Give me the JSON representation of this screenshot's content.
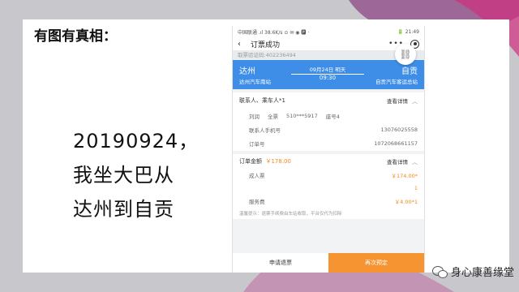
{
  "slide": {
    "heading": "有图有真相：",
    "lines": [
      "20190924，",
      "我坐大巴从",
      "达州到自贡"
    ]
  },
  "phone": {
    "status_left": "中国联通 .ıl 38.6K/s ⊙ ✉ ◉ 🅿 ·",
    "status_right": "🔋 21:49",
    "nav_title": "订票成功",
    "nav_dots": "•••",
    "order_number": "取票验证码:402236494",
    "route": {
      "from": "达州",
      "to": "自贡",
      "date": "09月24日 明天",
      "time": "09:30",
      "from_station": "达州汽车南站",
      "to_station": "自贡汽车客运总站"
    },
    "passenger_section": {
      "label": "联系人、乘车人*1",
      "link": "查看详情"
    },
    "passenger": {
      "name": "刘润",
      "ticket_type": "全票",
      "id": "510***5917",
      "seat": "座号4"
    },
    "contact": {
      "label": "联系人手机号",
      "value": "13076025558"
    },
    "order": {
      "label": "订单号",
      "value": "1072068661157"
    },
    "amount_section": {
      "label": "订单金额",
      "value": "￥178.00",
      "link": "查看详情"
    },
    "adult": {
      "label": "成人票",
      "price": "￥174.00*",
      "qty": "1"
    },
    "service": {
      "label": "服务费",
      "price": "￥4.00*1"
    },
    "tip": "温馨提示：退票手续费由车站收取，平台仅代为扣除",
    "refund_button": "申请退票",
    "again_button": "再次预定"
  },
  "watermark": "身心康善缘堂",
  "colors": {
    "accent_blue": "#3e8ee8",
    "accent_orange": "#f79432",
    "price_orange": "#f08a1c"
  }
}
